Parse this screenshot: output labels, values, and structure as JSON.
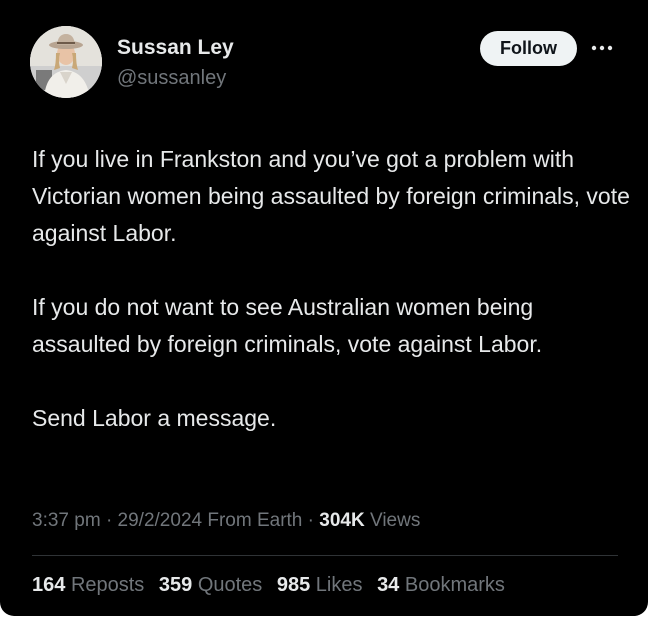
{
  "author": {
    "name": "Sussan Ley",
    "handle": "@sussanley",
    "avatar_icon": "profile-photo"
  },
  "actions": {
    "follow_label": "Follow",
    "more_icon": "more-horizontal-icon"
  },
  "tweet": {
    "paragraphs": [
      "If you live in Frankston and you’ve got a problem with Victorian women being assaulted by foreign criminals, vote against Labor.",
      "If you do not want to see Australian women being assaulted by foreign criminals, vote against Labor.",
      "Send Labor a message."
    ]
  },
  "meta": {
    "time": "3:37 pm",
    "date": "29/2/2024",
    "source": "From Earth",
    "views_count": "304K",
    "views_label": "Views",
    "separator": "·"
  },
  "stats": [
    {
      "count": "164",
      "label": "Reposts"
    },
    {
      "count": "359",
      "label": "Quotes"
    },
    {
      "count": "985",
      "label": "Likes"
    },
    {
      "count": "34",
      "label": "Bookmarks"
    }
  ],
  "colors": {
    "background": "#000000",
    "text": "#e7e9ea",
    "secondary_text": "#71767b",
    "follow_bg": "#eff3f4",
    "divider": "#2f3336"
  }
}
